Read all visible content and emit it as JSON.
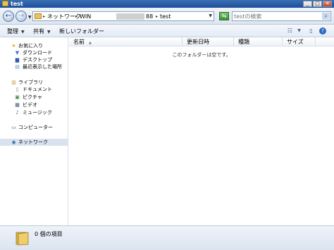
{
  "window": {
    "title": "test"
  },
  "title_buttons": {
    "minimize": "_",
    "maximize": "□",
    "close": "✕"
  },
  "address": {
    "back_glyph": "←",
    "forward_glyph": "→",
    "crumbs": [
      "ネットワーク",
      "WIN",
      "88",
      "test"
    ],
    "refresh_glyph": "⇆"
  },
  "search": {
    "placeholder": "testの検索",
    "button_glyph": "⌕"
  },
  "toolbar": {
    "organize_label": "整理",
    "share_label": "共有",
    "new_folder_label": "新しいフォルダー"
  },
  "nav": {
    "favorites": {
      "label": "お気に入り",
      "icon": "star-icon"
    },
    "favorites_items": [
      {
        "label": "ダウンロード",
        "icon": "download-folder-icon"
      },
      {
        "label": "デスクトップ",
        "icon": "desktop-icon"
      },
      {
        "label": "最近表示した場所",
        "icon": "recent-places-icon"
      }
    ],
    "libraries": {
      "label": "ライブラリ",
      "icon": "library-icon"
    },
    "libraries_items": [
      {
        "label": "ドキュメント",
        "icon": "documents-icon"
      },
      {
        "label": "ピクチャ",
        "icon": "pictures-icon"
      },
      {
        "label": "ビデオ",
        "icon": "videos-icon"
      },
      {
        "label": "ミュージック",
        "icon": "music-icon"
      }
    ],
    "computer": {
      "label": "コンピューター",
      "icon": "computer-icon"
    },
    "network": {
      "label": "ネットワーク",
      "icon": "network-icon",
      "selected": true
    }
  },
  "columns": {
    "name": "名前",
    "date": "更新日時",
    "type": "種類",
    "size": "サイズ"
  },
  "content": {
    "empty_message": "このフォルダーは空です。"
  },
  "details": {
    "item_count": "0 個の項目"
  },
  "colors": {
    "title_bar": "#1d4f98",
    "accent": "#3a6fb4",
    "selection": "#d9e3ef",
    "folder": "#e9c45c"
  }
}
